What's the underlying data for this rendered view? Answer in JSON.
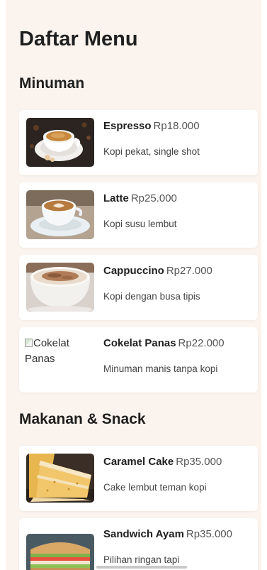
{
  "page": {
    "title": "Daftar Menu"
  },
  "sections": [
    {
      "title": "Minuman",
      "items": [
        {
          "name": "Espresso",
          "price": "Rp18.000",
          "description": "Kopi pekat, single shot",
          "image": "espresso-photo"
        },
        {
          "name": "Latte",
          "price": "Rp25.000",
          "description": "Kopi susu lembut",
          "image": "latte-photo"
        },
        {
          "name": "Cappuccino",
          "price": "Rp27.000",
          "description": "Kopi dengan busa tipis",
          "image": "cappuccino-photo"
        },
        {
          "name": "Cokelat Panas",
          "price": "Rp22.000",
          "description": "Minuman manis tanpa kopi",
          "image": "broken-image",
          "image_alt": "Cokelat Panas"
        }
      ]
    },
    {
      "title": "Makanan & Snack",
      "items": [
        {
          "name": "Caramel Cake",
          "price": "Rp35.000",
          "description": "Cake lembut teman kopi",
          "image": "caramel-cake-photo"
        },
        {
          "name": "Sandwich Ayam",
          "price": "Rp35.000",
          "description": "Pilihan ringan tapi",
          "image": "sandwich-photo"
        }
      ]
    }
  ],
  "colors": {
    "background": "#fbf3ed",
    "card": "#ffffff",
    "text": "#1f1f1f",
    "muted": "#555555"
  }
}
